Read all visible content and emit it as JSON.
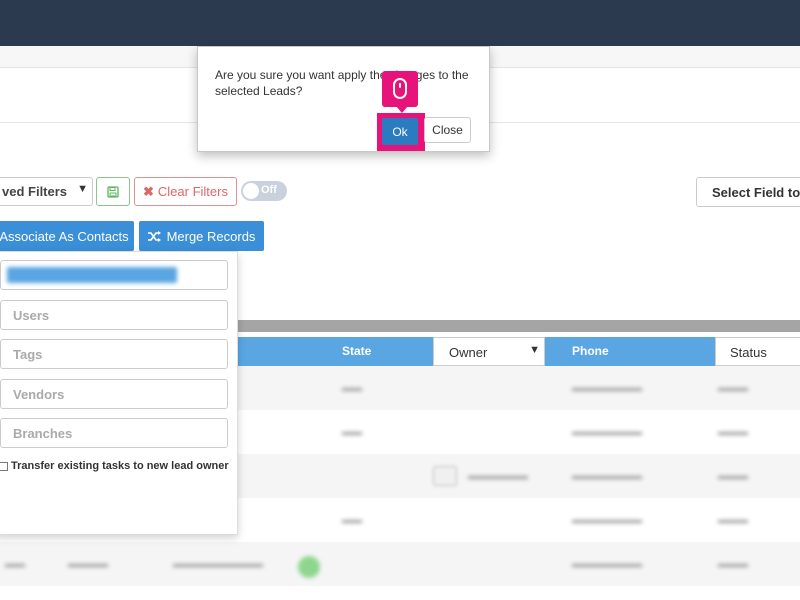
{
  "filters": {
    "saved_filters_label": "ved Filters",
    "clear_filters_label": "Clear Filters",
    "toggle_label": "Off",
    "select_field_label": "Select Field to"
  },
  "actions": {
    "associate_label": "Associate As Contacts",
    "merge_label": "Merge Records"
  },
  "table": {
    "headers": {
      "state": "State",
      "owner": "Owner",
      "phone": "Phone",
      "status": "Status"
    }
  },
  "panel": {
    "fields": [
      "Users",
      "Tags",
      "Vendors",
      "Branches"
    ],
    "transfer_label": "Transfer existing tasks to new lead owner"
  },
  "modal": {
    "message": "Are you sure you want apply the changes to the selected Leads?",
    "ok_label": "Ok",
    "close_label": "Close"
  },
  "colors": {
    "topbar": "#2c3a4f",
    "primary": "#3a8fd8",
    "table_header": "#5aa6e3",
    "highlight": "#e8137a"
  },
  "icons": [
    "chevron-down-icon",
    "save-icon",
    "times-icon",
    "shuffle-icon",
    "mouse-icon"
  ]
}
